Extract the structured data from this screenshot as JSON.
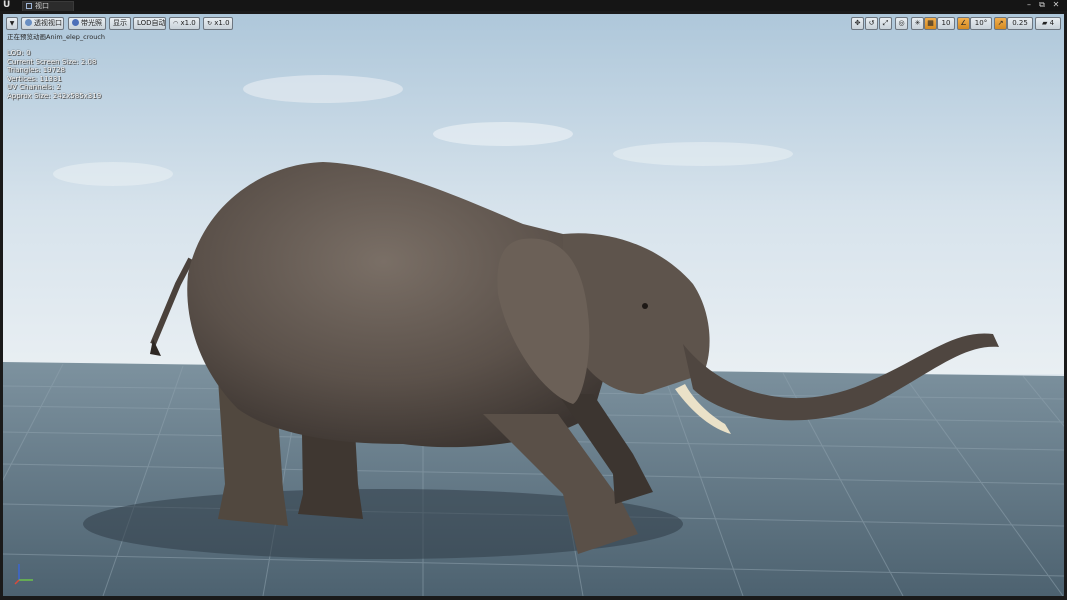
{
  "titlebar": {
    "logo": "U",
    "tab_label": "视口",
    "buttons": [
      "–",
      "⧉",
      "✕"
    ]
  },
  "toolbar": {
    "menu_icon": "chevron-down-icon",
    "perspective_label": "透视视口",
    "lit_label": "带光照",
    "show_label": "显示",
    "lod_label": "LOD自动",
    "speed_label": "x1.0",
    "rate_label": "x1.0",
    "grid_snap_value": "10",
    "rotation_snap_value": "10°",
    "scale_snap_value": "0.25",
    "camera_speed_value": "4"
  },
  "preview": {
    "status_text": "正在预览动画Anim_elep_crouch",
    "stats": [
      "LOD: 0",
      "Current Screen Size: 2.08",
      "Triangles: 19728",
      "Vertices: 11331",
      "UV Channels: 2",
      "Approx Size: 242x585x319"
    ]
  },
  "colors": {
    "sky_top": "#b8cfe0",
    "floor": "#5f7381",
    "floor_grid": "#8195a2",
    "elephant": "#5c524b",
    "accent_orange": "#e39a35"
  }
}
